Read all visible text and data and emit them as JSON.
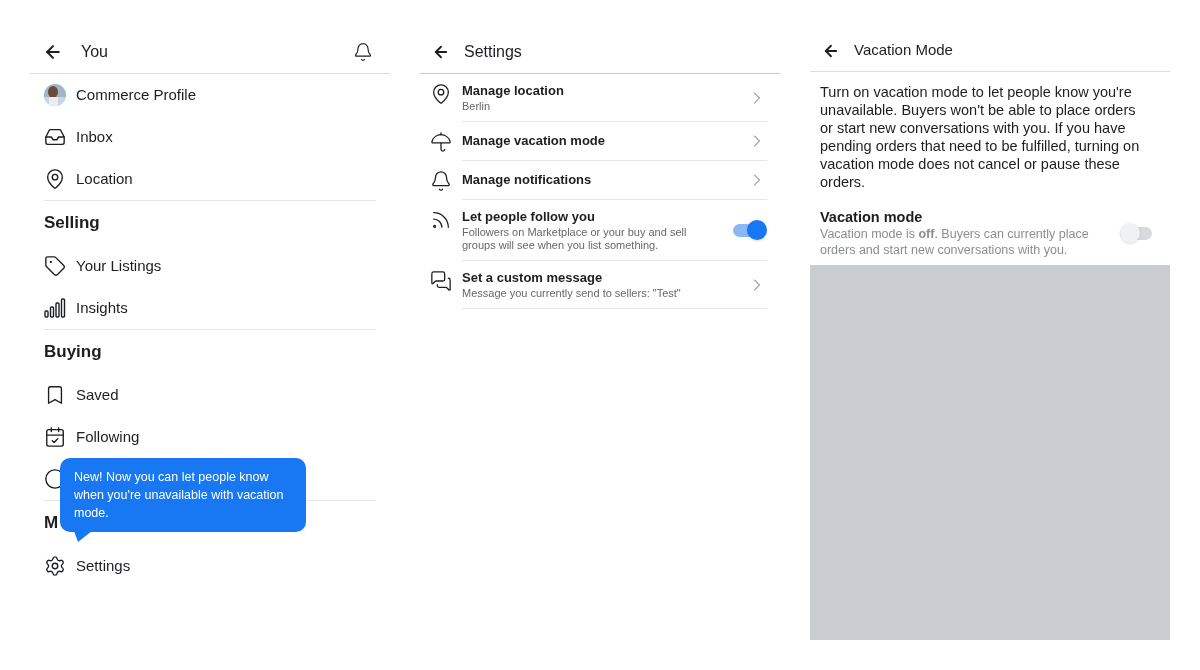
{
  "you_panel": {
    "title": "You",
    "sections": [
      {
        "items": [
          {
            "label": "Commerce Profile",
            "kind": "picture"
          },
          {
            "label": "Inbox",
            "kind": "icon"
          },
          {
            "label": "Location",
            "kind": "icon"
          }
        ]
      },
      {
        "heading": "Selling",
        "items": [
          {
            "label": "Your Listings",
            "kind": "icon"
          },
          {
            "label": "Insights",
            "kind": "icon"
          }
        ]
      },
      {
        "heading": "Buying",
        "items": [
          {
            "label": "Saved",
            "kind": "icon"
          },
          {
            "label": "Following",
            "kind": "icon"
          },
          {
            "kind": "icon"
          }
        ]
      },
      {
        "heading": "M",
        "items": [
          {
            "label": "Settings",
            "kind": "icon"
          }
        ]
      }
    ]
  },
  "tooltip": {
    "text": "New! Now you can let people know when you're unavailable with vacation mode."
  },
  "settings_panel": {
    "title": "Settings",
    "rows": [
      {
        "kind": "link",
        "title": "Manage location",
        "subtitle": "Berlin"
      },
      {
        "kind": "link",
        "title": "Manage vacation mode"
      },
      {
        "kind": "link",
        "title": "Manage notifications"
      },
      {
        "kind": "toggle",
        "title": "Let people follow you",
        "subtitle": "Followers on Marketplace or your buy and sell groups will see when you list something.",
        "on": true
      },
      {
        "kind": "link",
        "title": "Set a custom message",
        "subtitle": "Message you currently send to sellers: \"Test\""
      }
    ]
  },
  "vacation_panel": {
    "title": "Vacation Mode",
    "description": "Turn on vacation mode to let people know you're unavailable. Buyers won't be able to place orders or start new conversations with you. If you have pending orders that need to be fulfilled, turning on vacation mode does not cancel or pause these orders.",
    "setting": {
      "title": "Vacation mode",
      "subtitle": "Vacation mode is **off**. Buyers can currently place orders and start new conversations with you.",
      "on": false
    }
  }
}
